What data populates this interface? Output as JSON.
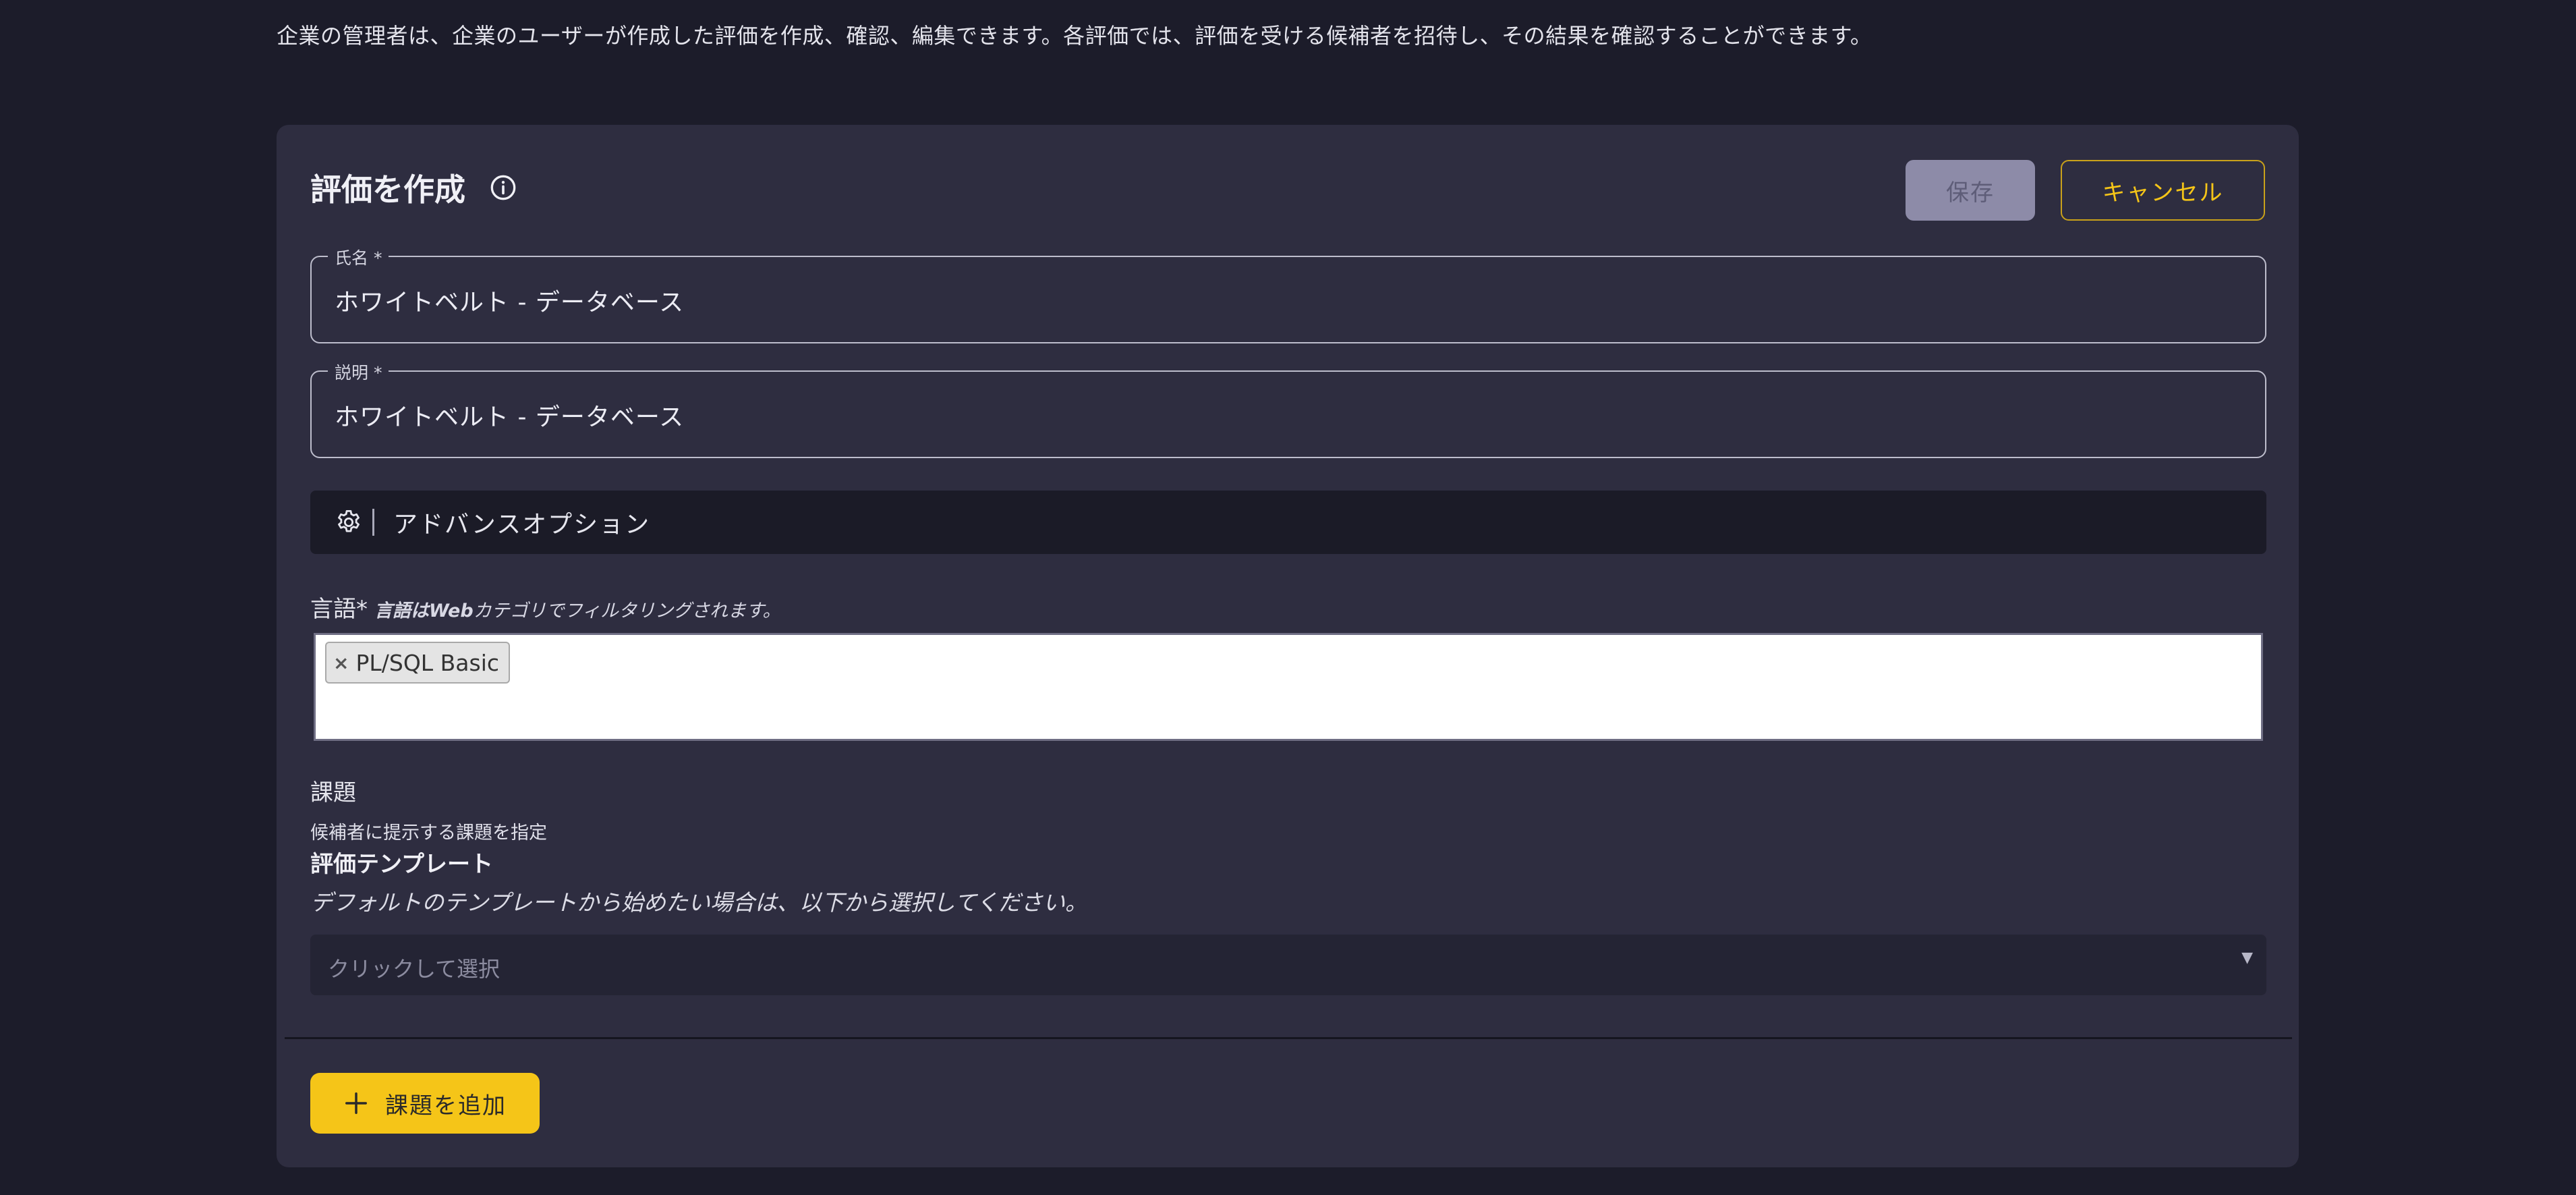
{
  "page": {
    "description": "企業の管理者は、企業のユーザーが作成した評価を作成、確認、編集できます。各評価では、評価を受ける候補者を招待し、その結果を確認することができます。"
  },
  "panel": {
    "title": "評価を作成",
    "save_label": "保存",
    "cancel_label": "キャンセル",
    "name_field": {
      "legend": "氏名 *",
      "value": "ホワイトベルト - データベース"
    },
    "description_field": {
      "legend": "説明 *",
      "value": "ホワイトベルト - データベース"
    },
    "advanced_options_label": "アドバンスオプション",
    "languages": {
      "label": "言語*",
      "hint_bold": "言語はWeb",
      "hint_rest": "カテゴリでフィルタリングされます。",
      "selected": [
        "PL/SQL Basic"
      ],
      "remove_glyph": "×"
    },
    "tasks": {
      "title": "課題",
      "subtitle": "候補者に提示する課題を指定"
    },
    "template": {
      "title": "評価テンプレート",
      "hint": "デフォルトのテンプレートから始めたい場合は、以下から選択してください。",
      "placeholder": "クリックして選択"
    },
    "add_task_label": "課題を追加"
  },
  "colors": {
    "background": "#1c1c2a",
    "panel": "#2e2d40",
    "accent": "#f5c518",
    "disabled_button": "#8d8ba8"
  },
  "icons": {
    "info": "info-icon",
    "gear": "gear-icon",
    "plus": "plus-icon",
    "caret": "caret-down-icon"
  }
}
